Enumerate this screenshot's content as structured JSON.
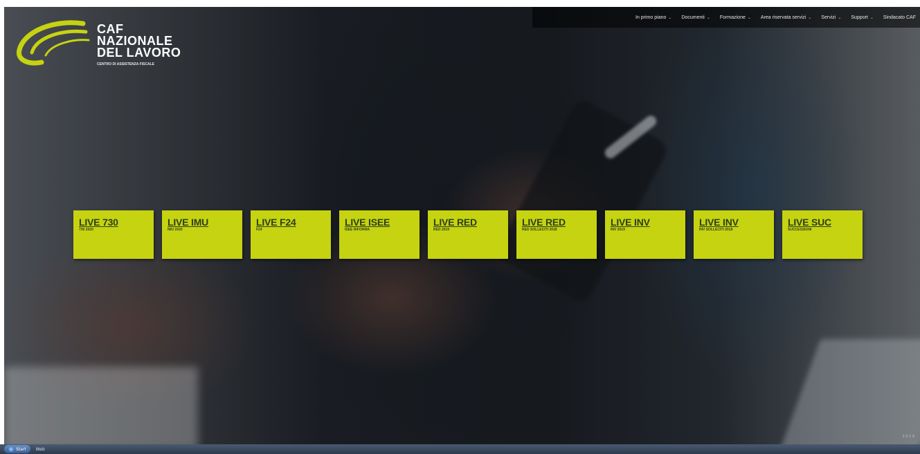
{
  "logo": {
    "line1": "CAF",
    "line2": "NAZIONALE",
    "line3": "DEL LAVORO",
    "subtitle": "CENTRO DI ASSISTENZA FISCALE"
  },
  "nav": {
    "items": [
      {
        "label": "In primo piano",
        "chevron": "chevron-down-icon"
      },
      {
        "label": "Documenti",
        "chevron": "chevron-down-icon"
      },
      {
        "label": "Formazione",
        "chevron": "chevron-down-icon"
      },
      {
        "label": "Area riservata servizi",
        "chevron": "chevron-down-icon"
      },
      {
        "label": "Servizi",
        "chevron": "chevron-down-icon"
      },
      {
        "label": "Support",
        "chevron": "chevron-down-icon"
      },
      {
        "label": "Sindacato CAF",
        "chevron": ""
      }
    ]
  },
  "tiles": [
    {
      "title": "LIVE 730",
      "sub": "730 2020"
    },
    {
      "title": "LIVE IMU",
      "sub": "IMU 2020"
    },
    {
      "title": "LIVE F24",
      "sub": "F24"
    },
    {
      "title": "LIVE ISEE",
      "sub": "ISEE RIFORMA"
    },
    {
      "title": "LIVE RED",
      "sub": "RED 2019"
    },
    {
      "title": "LIVE RED",
      "sub": "RED SOLLECITI 2018"
    },
    {
      "title": "LIVE INV",
      "sub": "INV 2019"
    },
    {
      "title": "LIVE INV",
      "sub": "INV SOLLECITI 2018"
    },
    {
      "title": "LIVE SUC",
      "sub": "SUCCESSIONI"
    }
  ],
  "corner": "2 0 1 9",
  "taskbar": {
    "start_label": "Start",
    "app_label": "Web"
  },
  "colors": {
    "tile": "#c6d311",
    "tile_text": "#2c3f1c",
    "logo_swoosh": "#c6d311"
  }
}
